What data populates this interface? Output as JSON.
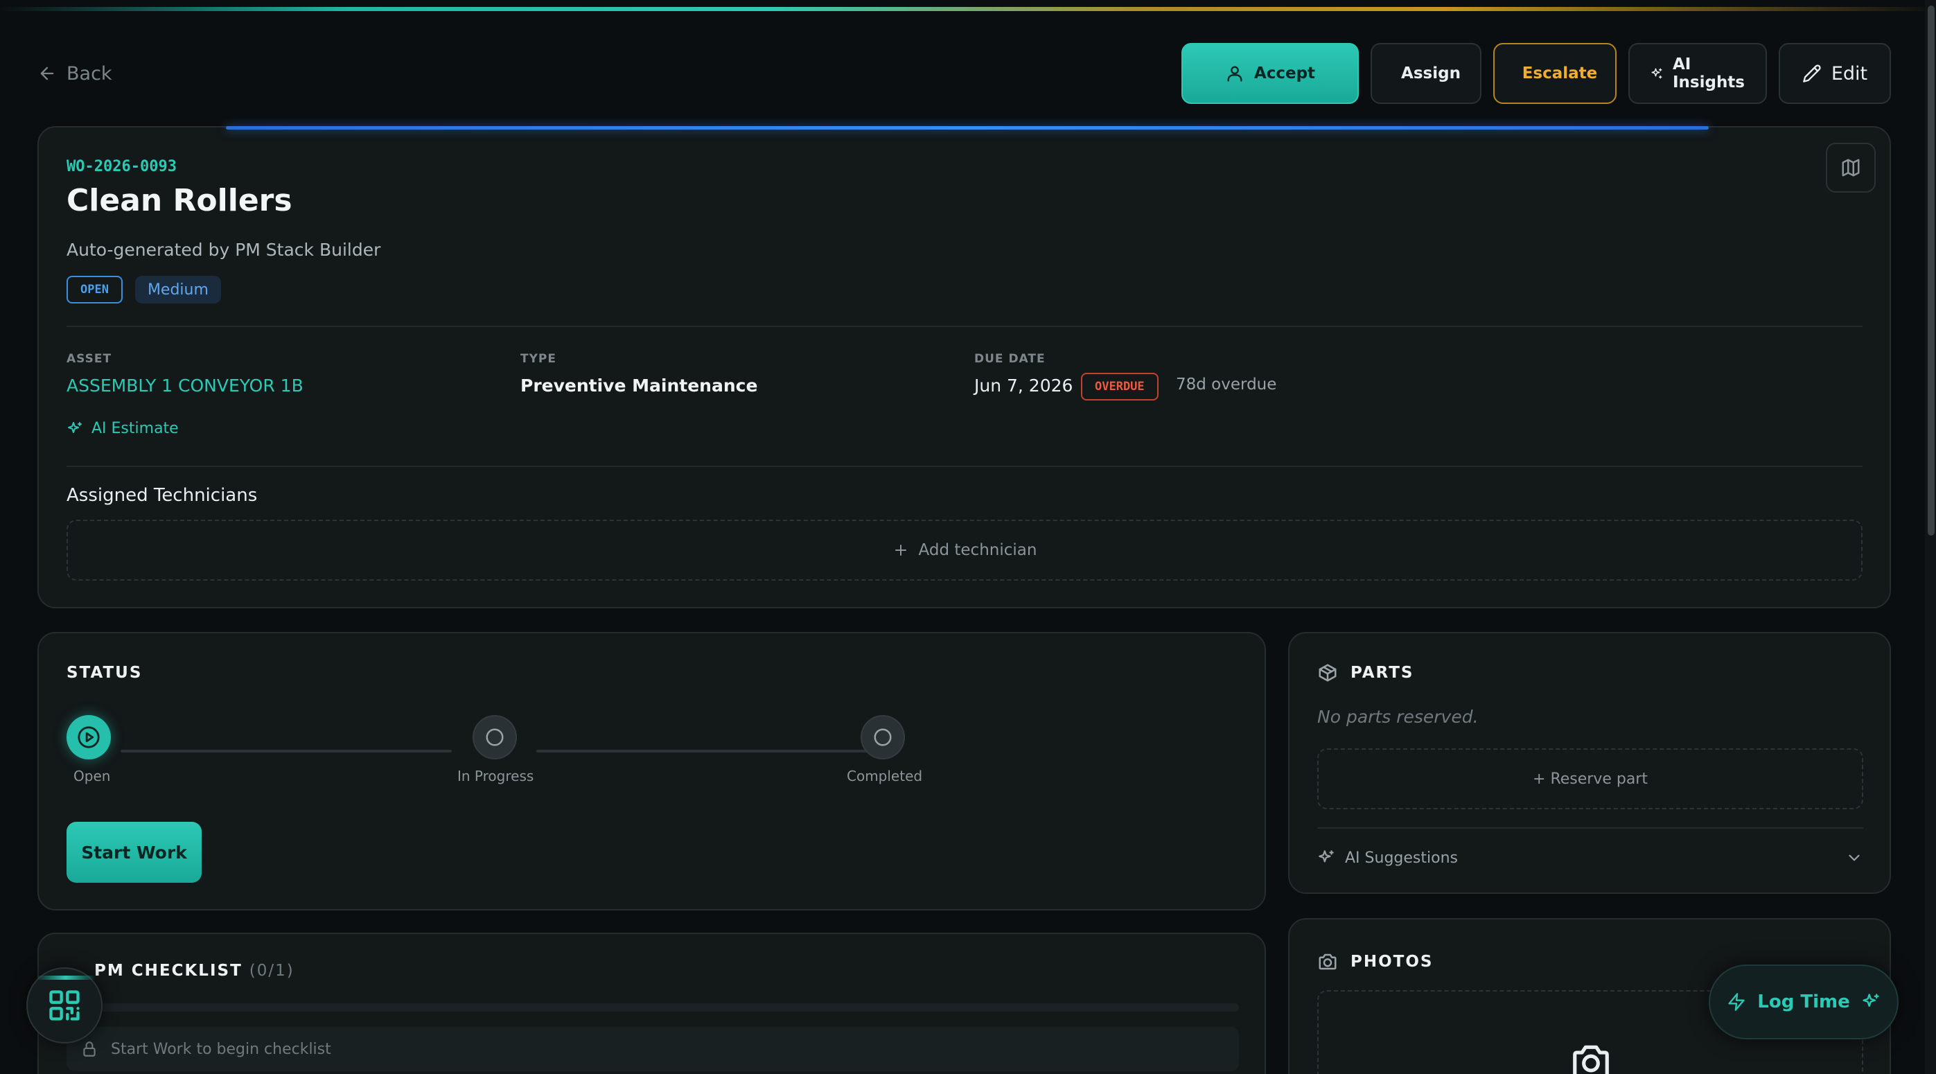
{
  "header": {
    "back_label": "Back",
    "actions": {
      "accept": "Accept",
      "assign": "Assign",
      "escalate": "Escalate",
      "ai_insights": "AI Insights",
      "edit": "Edit"
    }
  },
  "work_order": {
    "code": "WO-2026-0093",
    "title": "Clean Rollers",
    "subtitle": "Auto-generated by PM Stack Builder",
    "status_badge": "OPEN",
    "priority_badge": "Medium",
    "fields": {
      "asset_label": "ASSET",
      "asset_value": "ASSEMBLY 1 CONVEYOR 1B",
      "type_label": "TYPE",
      "type_value": "Preventive Maintenance",
      "due_label": "DUE DATE",
      "due_value": "Jun 7, 2026",
      "overdue_badge": "OVERDUE",
      "overdue_days": "78d overdue"
    },
    "ai_estimate": "AI Estimate",
    "technicians_title": "Assigned Technicians",
    "add_technician": "Add technician"
  },
  "status": {
    "title": "STATUS",
    "steps": [
      "Open",
      "In Progress",
      "Completed"
    ],
    "current_step": 0,
    "start_button": "Start Work"
  },
  "parts": {
    "title": "PARTS",
    "empty_text": "No parts reserved.",
    "reserve_button": "+ Reserve part",
    "ai_suggestions": "AI Suggestions"
  },
  "checklist": {
    "title": "PM CHECKLIST",
    "count": "(0/1)",
    "locked_text": "Start Work to begin checklist"
  },
  "photos": {
    "title": "PHOTOS"
  },
  "fab": {
    "log_time": "Log Time"
  },
  "colors": {
    "accent": "#2cc9b5",
    "escalate": "#f0ad2e",
    "overdue": "#ec5a40",
    "info": "#4aa0f0"
  }
}
